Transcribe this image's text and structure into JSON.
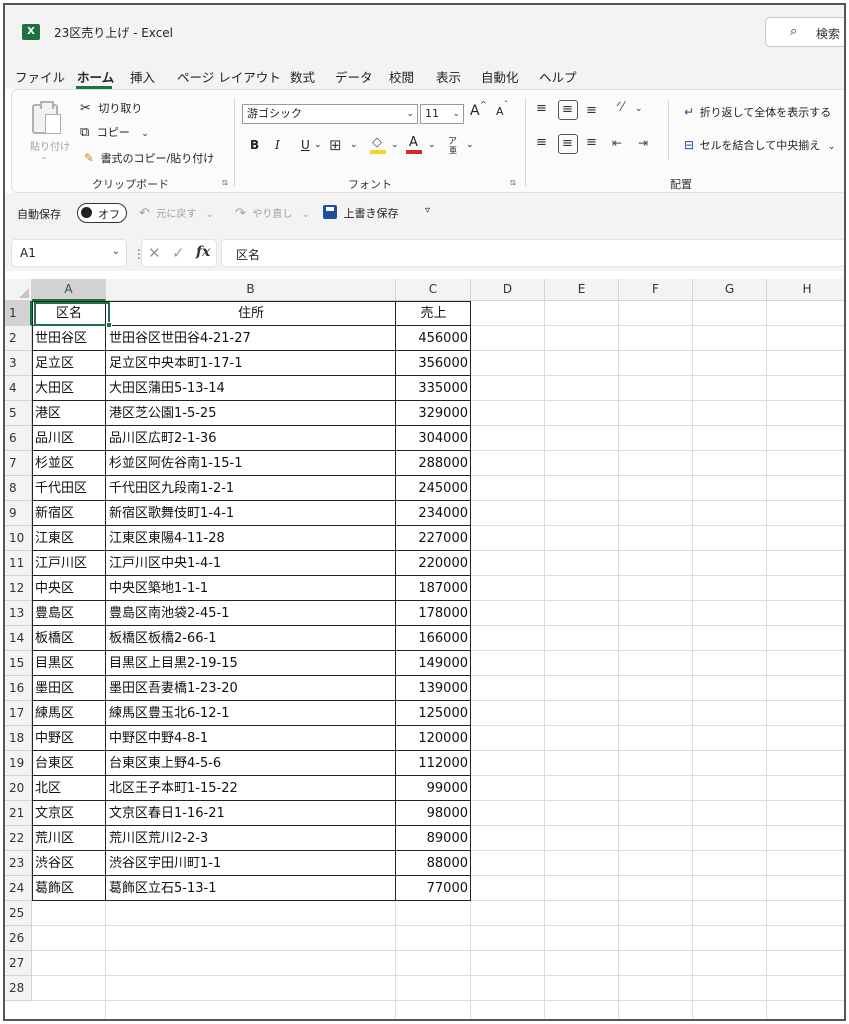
{
  "app": {
    "window_title": "23区売り上げ - Excel",
    "icon_letter": "X",
    "search_label": "検索"
  },
  "menu": [
    "ファイル",
    "ホーム",
    "挿入",
    "ページ レイアウト",
    "数式",
    "データ",
    "校閲",
    "表示",
    "自動化",
    "ヘルプ"
  ],
  "ribbon": {
    "clipboard": {
      "paste": "貼り付け",
      "cut": "切り取り",
      "copy": "コピー",
      "format_painter": "書式のコピー/貼り付け",
      "label": "クリップボード"
    },
    "font": {
      "font_name": "游ゴシック",
      "font_size": "11",
      "grow": "A",
      "shrink": "A",
      "bold": "B",
      "italic": "I",
      "underline": "U",
      "font_color_letter": "A",
      "phonetic": "ア",
      "label": "フォント"
    },
    "alignment": {
      "wrap": "折り返して全体を表示する",
      "merge": "セルを結合して中央揃え",
      "label": "配置"
    },
    "colors": {
      "fill": "#f5d327",
      "font_color": "#d62a2a",
      "accent": "#1e7145"
    }
  },
  "qat": {
    "autosave": "自動保存",
    "toggle": "オフ",
    "undo": "元に戻す",
    "redo": "やり直し",
    "overwrite_save": "上書き保存"
  },
  "formula_bar": {
    "name_box": "A1",
    "content": "区名"
  },
  "sheet": {
    "columns": [
      "A",
      "B",
      "C",
      "D",
      "E",
      "F",
      "G",
      "H"
    ],
    "row_numbers": [
      "1",
      "2",
      "3",
      "4",
      "5",
      "6",
      "7",
      "8",
      "9",
      "10",
      "11",
      "12",
      "13",
      "14",
      "15",
      "16",
      "17",
      "18",
      "19",
      "20",
      "21",
      "22",
      "23",
      "24",
      "25",
      "26",
      "27",
      "28"
    ],
    "header": [
      "区名",
      "住所",
      "売上"
    ],
    "rows": [
      [
        "世田谷区",
        "世田谷区世田谷4-21-27",
        "456000"
      ],
      [
        "足立区",
        "足立区中央本町1-17-1",
        "356000"
      ],
      [
        "大田区",
        "大田区蒲田5-13-14",
        "335000"
      ],
      [
        "港区",
        "港区芝公園1-5-25",
        "329000"
      ],
      [
        "品川区",
        "品川区広町2-1-36",
        "304000"
      ],
      [
        "杉並区",
        "杉並区阿佐谷南1-15-1",
        "288000"
      ],
      [
        "千代田区",
        "千代田区九段南1-2-1",
        "245000"
      ],
      [
        "新宿区",
        "新宿区歌舞伎町1-4-1",
        "234000"
      ],
      [
        "江東区",
        "江東区東陽4-11-28",
        "227000"
      ],
      [
        "江戸川区",
        "江戸川区中央1-4-1",
        "220000"
      ],
      [
        "中央区",
        "中央区築地1-1-1",
        "187000"
      ],
      [
        "豊島区",
        "豊島区南池袋2-45-1",
        "178000"
      ],
      [
        "板橋区",
        "板橋区板橋2-66-1",
        "166000"
      ],
      [
        "目黒区",
        "目黒区上目黒2-19-15",
        "149000"
      ],
      [
        "墨田区",
        "墨田区吾妻橋1-23-20",
        "139000"
      ],
      [
        "練馬区",
        "練馬区豊玉北6-12-1",
        "125000"
      ],
      [
        "中野区",
        "中野区中野4-8-1",
        "120000"
      ],
      [
        "台東区",
        "台東区東上野4-5-6",
        "112000"
      ],
      [
        "北区",
        "北区王子本町1-15-22",
        "99000"
      ],
      [
        "文京区",
        "文京区春日1-16-21",
        "98000"
      ],
      [
        "荒川区",
        "荒川区荒川2-2-3",
        "89000"
      ],
      [
        "渋谷区",
        "渋谷区宇田川町1-1",
        "88000"
      ],
      [
        "葛飾区",
        "葛飾区立石5-13-1",
        "77000"
      ]
    ]
  }
}
